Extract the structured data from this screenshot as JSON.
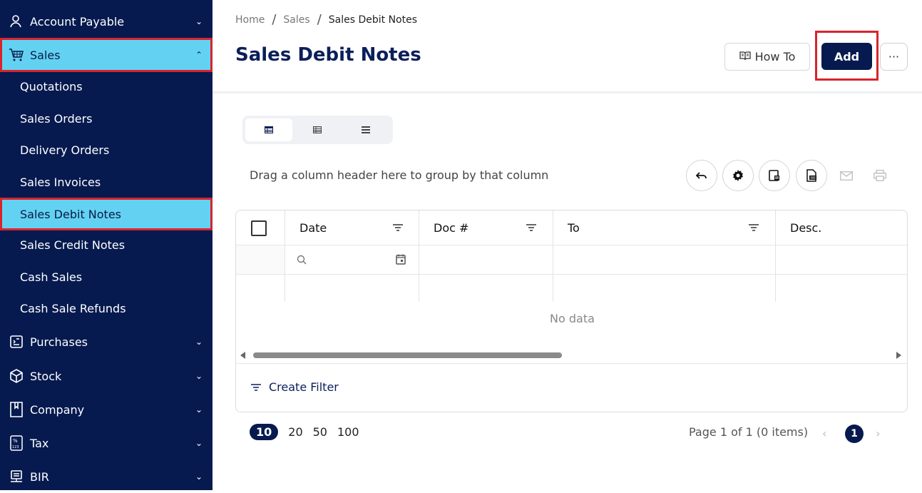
{
  "sidebar": {
    "groups": {
      "account_payable": {
        "label": "Account Payable",
        "icon": "user-icon"
      },
      "sales": {
        "label": "Sales",
        "icon": "cart-icon"
      },
      "purchases": {
        "label": "Purchases",
        "icon": "clipboard-icon"
      },
      "stock": {
        "label": "Stock",
        "icon": "cube-icon"
      },
      "company": {
        "label": "Company",
        "icon": "bookmark-icon"
      },
      "tax": {
        "label": "Tax",
        "icon": "percent-calc-icon"
      },
      "bir": {
        "label": "BIR",
        "icon": "monitor-icon"
      }
    },
    "sales_items": [
      "Quotations",
      "Sales Orders",
      "Delivery Orders",
      "Sales Invoices",
      "Sales Debit Notes",
      "Sales Credit Notes",
      "Cash Sales",
      "Cash Sale Refunds"
    ]
  },
  "breadcrumb": {
    "home": "Home",
    "section": "Sales",
    "current": "Sales Debit Notes",
    "separator": "/"
  },
  "page": {
    "title": "Sales Debit Notes"
  },
  "actions": {
    "how_to": "How To",
    "add": "Add",
    "more": "···"
  },
  "grid": {
    "group_hint": "Drag a column header here to group by that column",
    "columns": [
      "Date",
      "Doc #",
      "To",
      "Desc."
    ],
    "no_data": "No data",
    "create_filter": "Create Filter"
  },
  "pager": {
    "sizes": [
      "10",
      "20",
      "50",
      "100"
    ],
    "selected_size": "10",
    "info": "Page 1 of 1 (0 items)",
    "current_page": "1",
    "prev": "‹",
    "next": "›"
  },
  "colors": {
    "sidebar_bg": "#061a4f",
    "active_bg": "#63d2f2",
    "primary": "#061a4f",
    "highlight_outline": "#d9232d"
  }
}
